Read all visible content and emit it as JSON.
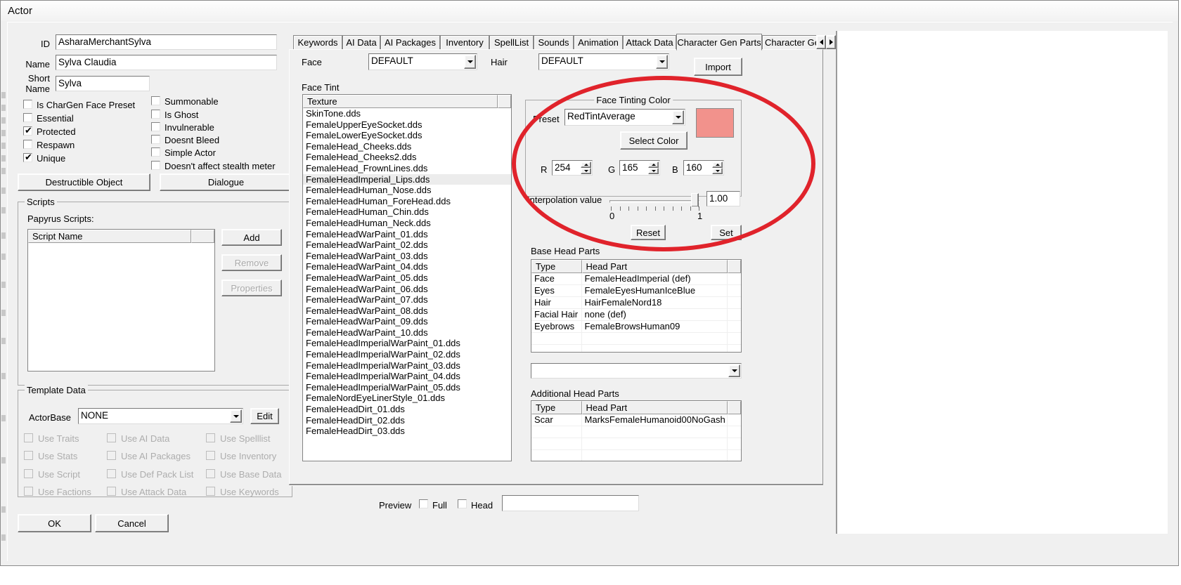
{
  "window": {
    "title": "Actor"
  },
  "left": {
    "fields": [
      {
        "label": "ID",
        "value": "AsharaMerchantSylva"
      },
      {
        "label": "Name",
        "value": "Sylva Claudia"
      },
      {
        "label": "Short Name",
        "value": "Sylva"
      }
    ],
    "checkboxes_col1": [
      {
        "label": "Is CharGen Face Preset",
        "checked": false
      },
      {
        "label": "Essential",
        "checked": false
      },
      {
        "label": "Protected",
        "checked": true
      },
      {
        "label": "Respawn",
        "checked": false
      },
      {
        "label": "Unique",
        "checked": true
      }
    ],
    "checkboxes_col2": [
      {
        "label": "Summonable",
        "checked": false
      },
      {
        "label": "Is Ghost",
        "checked": false
      },
      {
        "label": "Invulnerable",
        "checked": false
      },
      {
        "label": "Doesnt Bleed",
        "checked": false
      },
      {
        "label": "Simple Actor",
        "checked": false
      },
      {
        "label": "Doesn't affect stealth meter",
        "checked": false
      }
    ],
    "destructible_button": "Destructible Object",
    "dialogue_button": "Dialogue",
    "scripts": {
      "group_caption": "Scripts",
      "sublabel": "Papyrus Scripts:",
      "column_header": "Script Name",
      "rows": [],
      "buttons": [
        {
          "label": "Add",
          "enabled": true
        },
        {
          "label": "Remove",
          "enabled": false
        },
        {
          "label": "Properties",
          "enabled": false
        }
      ]
    },
    "template_data": {
      "group_caption": "Template Data",
      "actorbase_label": "ActorBase",
      "actorbase_value": "NONE",
      "edit_button": "Edit",
      "checkboxes": [
        {
          "label": "Use Traits",
          "checked": false
        },
        {
          "label": "Use AI Data",
          "checked": false
        },
        {
          "label": "Use Spelllist",
          "checked": false
        },
        {
          "label": "Use Stats",
          "checked": false
        },
        {
          "label": "Use AI Packages",
          "checked": false
        },
        {
          "label": "Use Inventory",
          "checked": false
        },
        {
          "label": "Use Script",
          "checked": false
        },
        {
          "label": "Use Def Pack List",
          "checked": false
        },
        {
          "label": "Use Base Data",
          "checked": false
        },
        {
          "label": "Use Factions",
          "checked": false
        },
        {
          "label": "Use Attack Data",
          "checked": false
        },
        {
          "label": "Use Keywords",
          "checked": false
        }
      ]
    },
    "ok_button": "OK",
    "cancel_button": "Cancel"
  },
  "tabs": {
    "items": [
      {
        "label": "Keywords",
        "active": false
      },
      {
        "label": "AI Data",
        "active": false
      },
      {
        "label": "AI Packages",
        "active": false
      },
      {
        "label": "Inventory",
        "active": false
      },
      {
        "label": "SpellList",
        "active": false
      },
      {
        "label": "Sounds",
        "active": false
      },
      {
        "label": "Animation",
        "active": false
      },
      {
        "label": "Attack Data",
        "active": false
      },
      {
        "label": "Character Gen Parts",
        "active": true
      },
      {
        "label": "Character Ge",
        "active": false
      }
    ],
    "scroll_left": "◄",
    "scroll_right": "►"
  },
  "chargen": {
    "face_label": "Face",
    "face_value": "DEFAULT",
    "hair_label": "Hair",
    "hair_value": "DEFAULT",
    "import_button": "Import",
    "face_tint_label": "Face Tint",
    "texture_header": "Texture",
    "textures": [
      "SkinTone.dds",
      "FemaleUpperEyeSocket.dds",
      "FemaleLowerEyeSocket.dds",
      "FemaleHead_Cheeks.dds",
      "FemaleHead_Cheeks2.dds",
      "FemaleHead_FrownLines.dds",
      "FemaleHeadImperial_Lips.dds",
      "FemaleHeadHuman_Nose.dds",
      "FemaleHeadHuman_ForeHead.dds",
      "FemaleHeadHuman_Chin.dds",
      "FemaleHeadHuman_Neck.dds",
      "FemaleHeadWarPaint_01.dds",
      "FemaleHeadWarPaint_02.dds",
      "FemaleHeadWarPaint_03.dds",
      "FemaleHeadWarPaint_04.dds",
      "FemaleHeadWarPaint_05.dds",
      "FemaleHeadWarPaint_06.dds",
      "FemaleHeadWarPaint_07.dds",
      "FemaleHeadWarPaint_08.dds",
      "FemaleHeadWarPaint_09.dds",
      "FemaleHeadWarPaint_10.dds",
      "FemaleHeadImperialWarPaint_01.dds",
      "FemaleHeadImperialWarPaint_02.dds",
      "FemaleHeadImperialWarPaint_03.dds",
      "FemaleHeadImperialWarPaint_04.dds",
      "FemaleHeadImperialWarPaint_05.dds",
      "FemaleNordEyeLinerStyle_01.dds",
      "FemaleHeadDirt_01.dds",
      "FemaleHeadDirt_02.dds",
      "FemaleHeadDirt_03.dds"
    ],
    "selected_texture": "FemaleHeadImperial_Lips.dds",
    "selected_texture_index": 6,
    "face_tinting_color": {
      "group_caption": "Face Tinting Color",
      "preset_label": "Preset",
      "preset_value": "RedTintAverage",
      "select_color_button": "Select Color",
      "swatch_hex": "#f2928c",
      "r_label": "R",
      "r_value": "254",
      "g_label": "G",
      "g_value": "165",
      "b_label": "B",
      "b_value": "160"
    },
    "interpolation": {
      "label": "Interpolation value",
      "value": "1.00",
      "min_label": "0",
      "max_label": "1",
      "reset_button": "Reset",
      "set_button": "Set",
      "slider_percent": 100
    },
    "base_head_parts": {
      "label": "Base Head Parts",
      "headers": [
        "Type",
        "Head Part",
        ""
      ],
      "rows": [
        {
          "type": "Face",
          "part": "FemaleHeadImperial (def)"
        },
        {
          "type": "Eyes",
          "part": "FemaleEyesHumanIceBlue"
        },
        {
          "type": "Hair",
          "part": "HairFemaleNord18"
        },
        {
          "type": "Facial Hair",
          "part": "none (def)"
        },
        {
          "type": "Eyebrows",
          "part": "FemaleBrowsHuman09"
        }
      ],
      "dropdown_value": ""
    },
    "additional_head_parts": {
      "label": "Additional Head Parts",
      "headers": [
        "Type",
        "Head Part",
        ""
      ],
      "rows": [
        {
          "type": "Scar",
          "part": "MarksFemaleHumanoid00NoGash"
        }
      ]
    },
    "preview": {
      "label": "Preview",
      "full_label": "Full",
      "full_checked": false,
      "head_label": "Head",
      "head_checked": false,
      "field_value": ""
    }
  },
  "annotation": {
    "highlight_color": "#e0232b",
    "shape": "ellipse"
  }
}
